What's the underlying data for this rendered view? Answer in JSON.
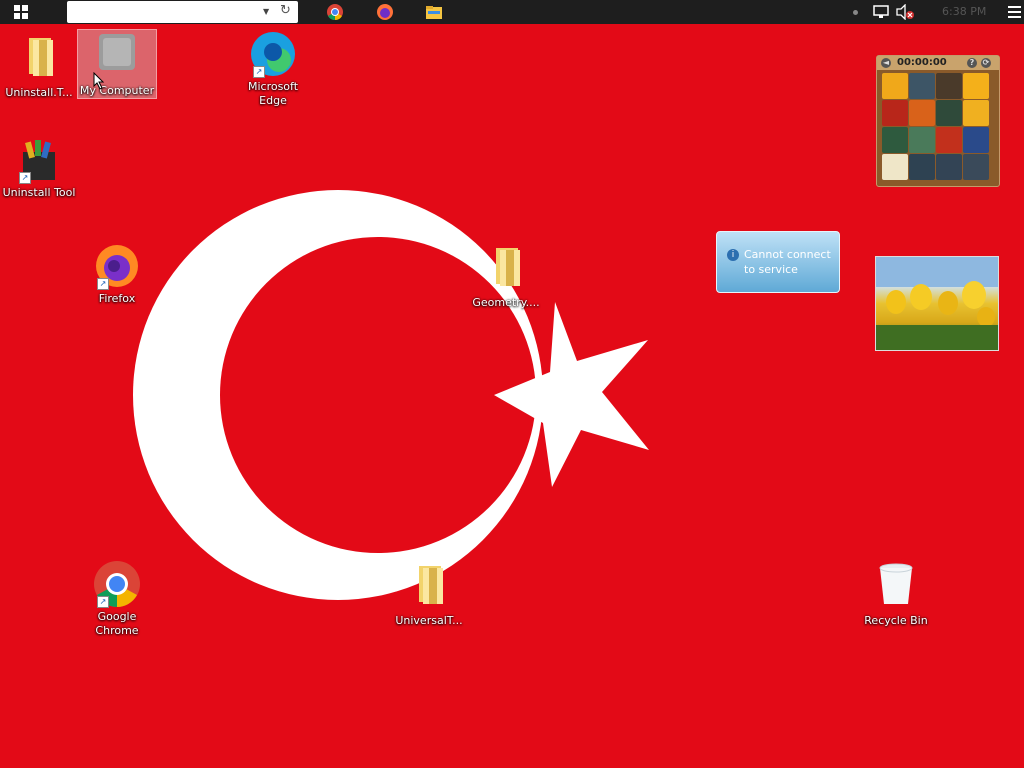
{
  "taskbar": {
    "address_value": "",
    "clock": "6:38 PM",
    "apps": [
      "chrome-icon",
      "firefox-icon",
      "file-explorer-icon"
    ]
  },
  "desktop": {
    "icons": [
      {
        "label": "Uninstall.T..."
      },
      {
        "label": "My Computer"
      },
      {
        "label": "Microsoft Edge"
      },
      {
        "label": "Uninstall Tool"
      },
      {
        "label": "Firefox"
      },
      {
        "label": "Geometry...."
      },
      {
        "label": "Google Chrome"
      },
      {
        "label": "UniversalT..."
      },
      {
        "label": "Recycle Bin"
      }
    ]
  },
  "gadgets": {
    "puzzle_timer": "00:00:00",
    "weather_message": "Cannot connect to service"
  },
  "colors": {
    "flag_red": "#e30a17",
    "taskbar": "#1e1e1e"
  }
}
